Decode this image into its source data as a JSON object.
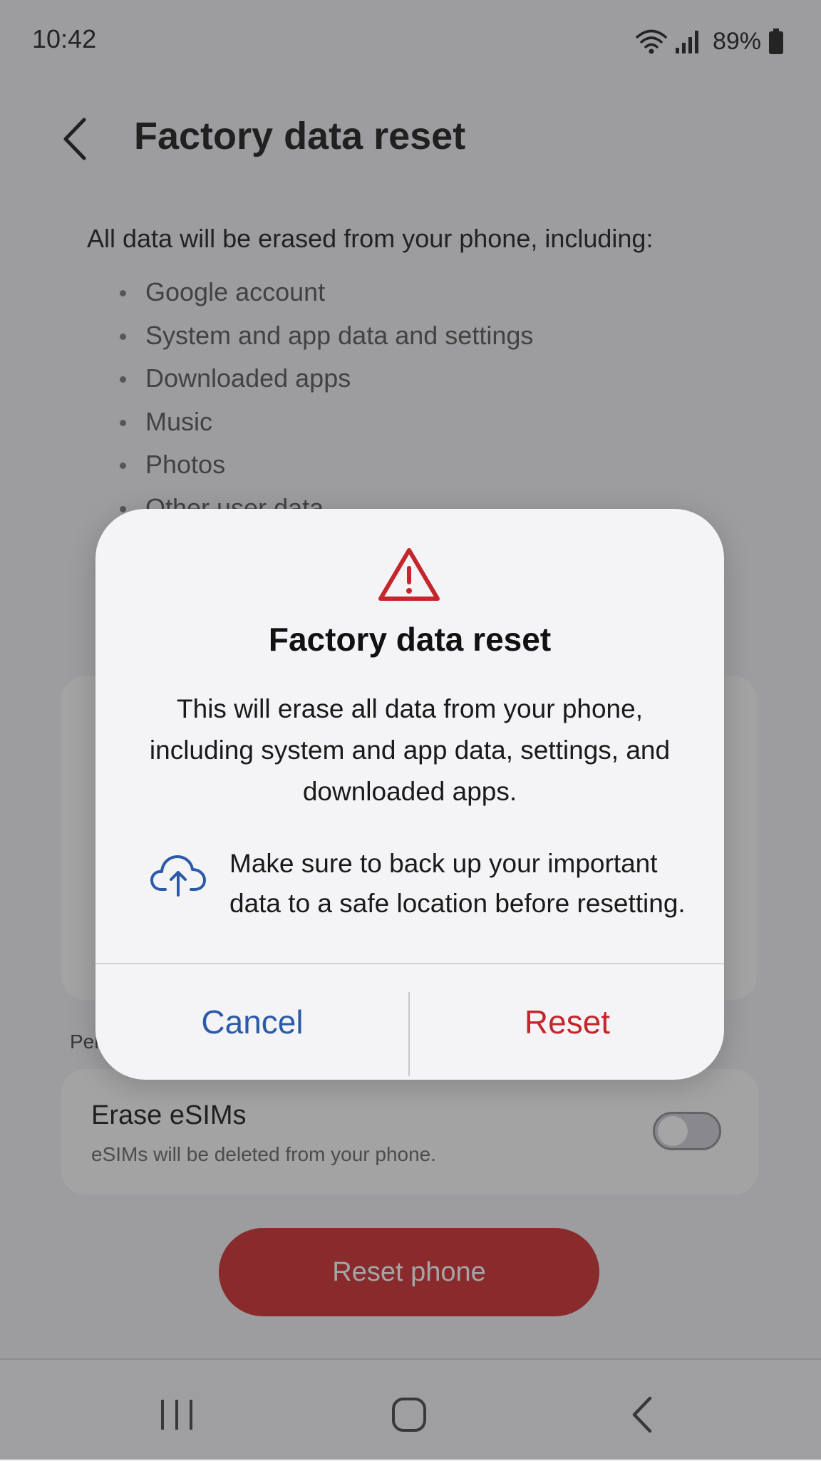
{
  "status_bar": {
    "time": "10:42",
    "battery": "89%"
  },
  "header": {
    "title": "Factory data reset"
  },
  "content": {
    "intro": "All data will be erased from your phone, including:",
    "items": [
      "Google account",
      "System and app data and settings",
      "Downloaded apps",
      "Music",
      "Photos",
      "Other user data"
    ],
    "section_label": "Per",
    "esim": {
      "title": "Erase eSIMs",
      "description": "eSIMs will be deleted from your phone.",
      "enabled": false
    },
    "reset_button": "Reset phone"
  },
  "dialog": {
    "title": "Factory data reset",
    "body": "This will erase all data from your phone, including system and app data, settings, and downloaded apps.",
    "backup_note": "Make sure to back up your important data to a safe location before resetting.",
    "cancel_label": "Cancel",
    "reset_label": "Reset"
  },
  "icons": {
    "warning": "warning-triangle-icon",
    "cloud": "cloud-upload-icon",
    "back": "back-arrow-icon",
    "wifi": "wifi-icon",
    "signal": "signal-icon",
    "battery": "battery-icon"
  },
  "colors": {
    "accent_blue": "#2a5aa8",
    "danger_red": "#c4262c",
    "button_red": "#cf2b2e"
  }
}
